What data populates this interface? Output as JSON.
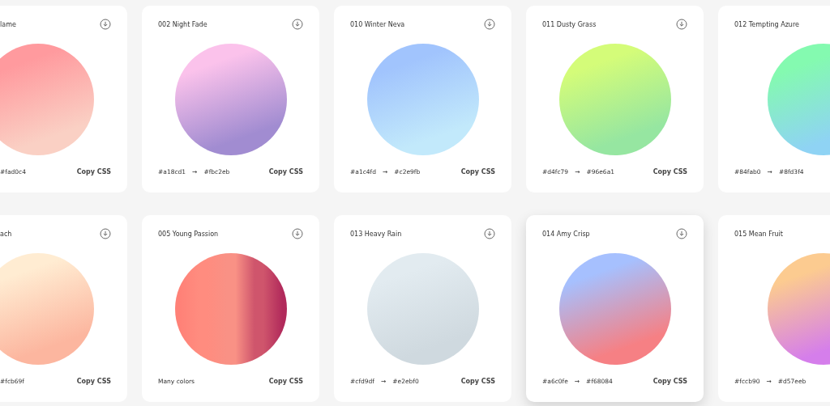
{
  "gradients": [
    {
      "title": "lame",
      "to": "#fad0c4",
      "copy": "Copy CSS",
      "raised": false,
      "stops": [
        {
          "color": "#ff9a9e"
        },
        {
          "color": "#fad0c4"
        }
      ]
    },
    {
      "title": "002 Night Fade",
      "from": "#a18cd1",
      "arrow": "→",
      "to": "#fbc2eb",
      "copy": "Copy CSS",
      "raised": false,
      "stops": [
        {
          "color": "#fbc2eb"
        },
        {
          "color": "#a18cd1"
        }
      ]
    },
    {
      "title": "010 Winter Neva",
      "from": "#a1c4fd",
      "arrow": "→",
      "to": "#c2e9fb",
      "copy": "Copy CSS",
      "raised": false,
      "stops": [
        {
          "color": "#a1c4fd"
        },
        {
          "color": "#c2e9fb"
        }
      ]
    },
    {
      "title": "011 Dusty Grass",
      "from": "#d4fc79",
      "arrow": "→",
      "to": "#96e6a1",
      "copy": "Copy CSS",
      "raised": false,
      "stops": [
        {
          "color": "#d4fc79"
        },
        {
          "color": "#96e6a1"
        }
      ]
    },
    {
      "title": "012 Tempting Azure",
      "from": "#84fab0",
      "arrow": "→",
      "to": "#8fd3f4",
      "raised": false,
      "stops": [
        {
          "color": "#84fab0"
        },
        {
          "color": "#8fd3f4"
        }
      ]
    },
    {
      "title": "ach",
      "to": "#fcb69f",
      "copy": "Copy CSS",
      "raised": false,
      "stops": [
        {
          "color": "#ffecd2"
        },
        {
          "color": "#fcb69f"
        }
      ]
    },
    {
      "title": "005 Young Passion",
      "note": "Many colors",
      "copy": "Copy CSS",
      "raised": false,
      "stops": [
        {
          "color": "#ff8177"
        },
        {
          "color": "#ff8c7f"
        },
        {
          "color": "#f99185"
        },
        {
          "color": "#cf556c"
        },
        {
          "color": "#b12a5b"
        }
      ]
    },
    {
      "title": "013 Heavy Rain",
      "from": "#cfd9df",
      "arrow": "→",
      "to": "#e2ebf0",
      "copy": "Copy CSS",
      "raised": false,
      "stops": [
        {
          "color": "#e2ebf0"
        },
        {
          "color": "#cfd9df"
        }
      ]
    },
    {
      "title": "014 Amy Crisp",
      "from": "#a6c0fe",
      "arrow": "→",
      "to": "#f68084",
      "copy": "Copy CSS",
      "raised": true,
      "stops": [
        {
          "color": "#a6c0fe"
        },
        {
          "color": "#f68084"
        }
      ]
    },
    {
      "title": "015 Mean Fruit",
      "from": "#fccb90",
      "arrow": "→",
      "to": "#d57eeb",
      "raised": false,
      "stops": [
        {
          "color": "#fccb90"
        },
        {
          "color": "#d57eeb"
        }
      ]
    }
  ]
}
